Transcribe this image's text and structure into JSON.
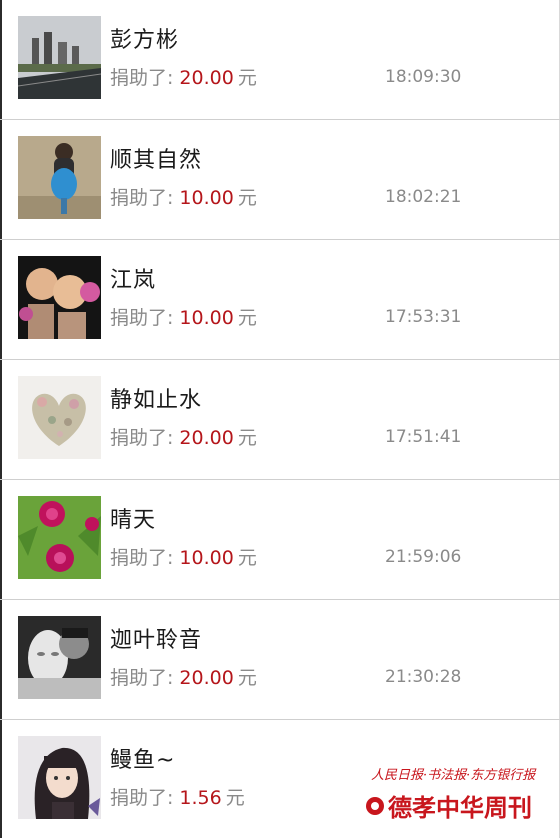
{
  "donation_label": "捐助了:",
  "currency": "元",
  "donors": [
    {
      "name": "彭方彬",
      "amount": "20.00",
      "time": "18:09:30"
    },
    {
      "name": "顺其自然",
      "amount": "10.00",
      "time": "18:02:21"
    },
    {
      "name": "江岚",
      "amount": "10.00",
      "time": "17:53:31"
    },
    {
      "name": "静如止水",
      "amount": "20.00",
      "time": "17:51:41"
    },
    {
      "name": "晴天",
      "amount": "10.00",
      "time": "21:59:06"
    },
    {
      "name": "迦叶聆音",
      "amount": "20.00",
      "time": "21:30:28"
    },
    {
      "name": "鳗鱼~",
      "amount": "1.56",
      "time": ""
    }
  ],
  "watermark": {
    "top_line": "人民日报·书法报·东方银行报",
    "brand": "德孝中华周刊"
  },
  "colors": {
    "amount": "#b5161b",
    "watermark": "#c8161d"
  }
}
